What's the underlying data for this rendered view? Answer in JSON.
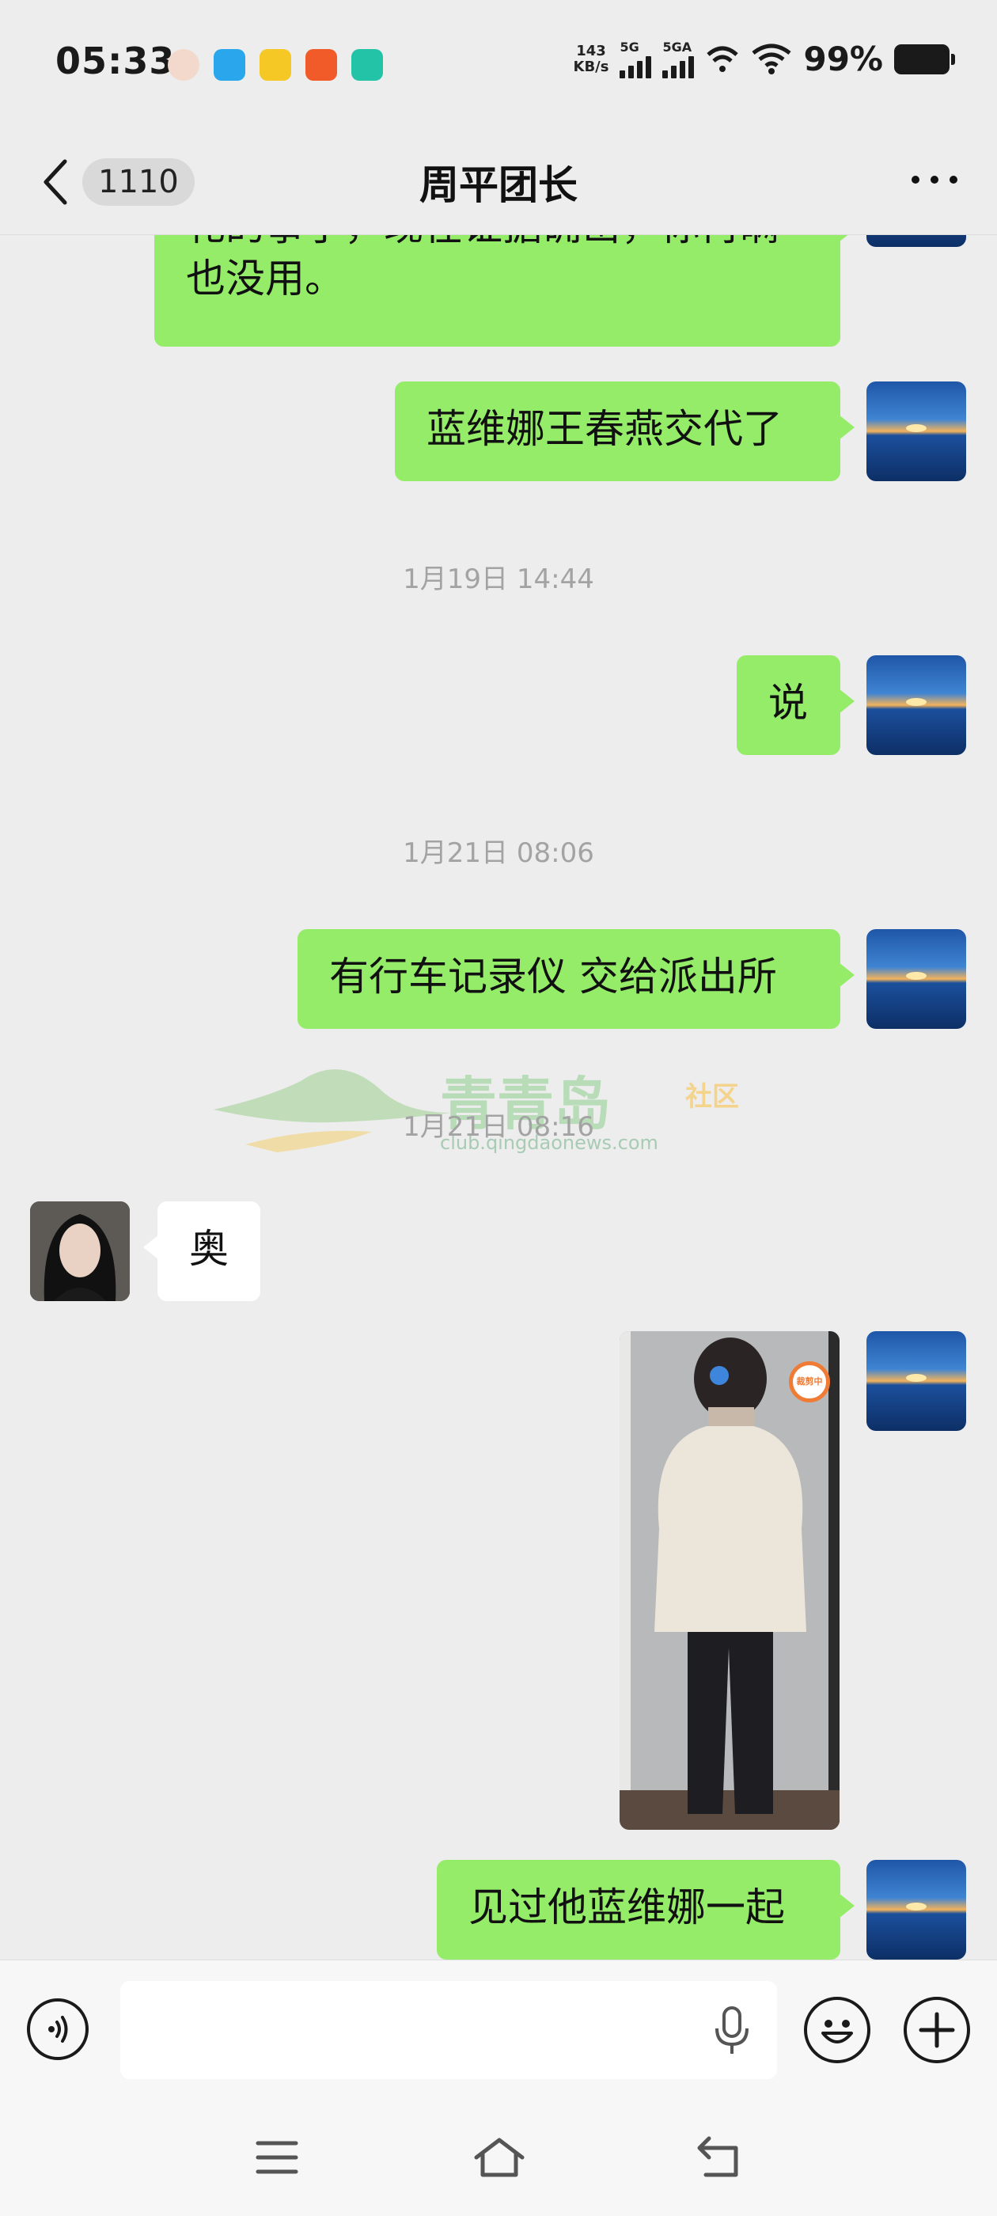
{
  "status_bar": {
    "time": "05:33",
    "net_speed_value": "143",
    "net_speed_unit": "KB/s",
    "signal1_label": "5G",
    "signal2_label": "5GA",
    "battery": "99%"
  },
  "header": {
    "unread_count": "1110",
    "title": "周平团长"
  },
  "messages": [
    {
      "side": "right",
      "text_line1": "礼的事了，现在证据确凿，你再瞒",
      "text_line2": "也没用。"
    },
    {
      "side": "right",
      "text": "蓝维娜王春燕交代了"
    },
    {
      "type": "timestamp",
      "text": "1月19日 14:44"
    },
    {
      "side": "right",
      "text": "说"
    },
    {
      "type": "timestamp",
      "text": "1月21日 08:06"
    },
    {
      "side": "right",
      "text": "有行车记录仪 交给派出所"
    },
    {
      "type": "timestamp",
      "text": "1月21日 08:16"
    },
    {
      "side": "left",
      "text": "奥"
    },
    {
      "side": "right",
      "type": "image",
      "badge": "裁剪中"
    },
    {
      "side": "right",
      "text": "见过他蓝维娜一起"
    }
  ],
  "watermark": {
    "name": "青青岛",
    "tag": "社区",
    "url": "club.qingdaonews.com"
  },
  "input_bar": {
    "placeholder": ""
  },
  "icons": {
    "back": "chevron-left-icon",
    "more": "more-dots-icon",
    "voice": "voice-icon",
    "mic": "microphone-icon",
    "emoji": "emoji-icon",
    "plus": "plus-icon",
    "nav_menu": "menu-icon",
    "nav_home": "home-icon",
    "nav_back": "back-icon"
  },
  "colors": {
    "background": "#ededed",
    "bubble_self": "#95ec69",
    "bubble_other": "#ffffff",
    "timestamp": "#a3a3a3"
  }
}
